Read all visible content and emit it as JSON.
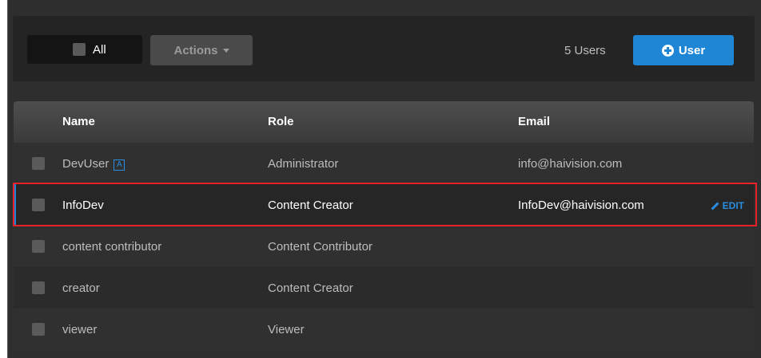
{
  "toolbar": {
    "select_all_label": "All",
    "actions_label": "Actions",
    "user_count": "5 Users",
    "add_user_label": "User"
  },
  "table": {
    "headers": {
      "name": "Name",
      "role": "Role",
      "email": "Email"
    },
    "rows": [
      {
        "name": "DevUser",
        "badge": "A",
        "role": "Administrator",
        "email": "info@haivision.com"
      },
      {
        "name": "InfoDev",
        "role": "Content Creator",
        "email": "InfoDev@haivision.com",
        "action": "EDIT"
      },
      {
        "name": "content contributor",
        "role": "Content Contributor",
        "email": ""
      },
      {
        "name": "creator",
        "role": "Content Creator",
        "email": ""
      },
      {
        "name": "viewer",
        "role": "Viewer",
        "email": ""
      }
    ]
  },
  "colors": {
    "accent": "#1f86d6",
    "highlight": "#e8202a",
    "background": "#2e2e2e"
  }
}
